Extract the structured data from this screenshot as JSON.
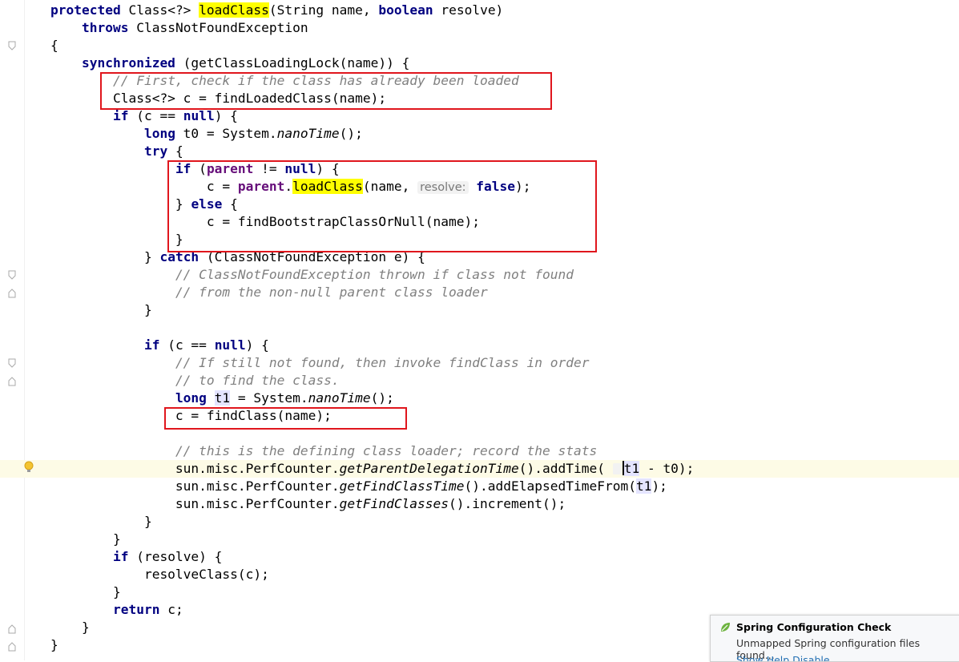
{
  "editor": {
    "lines": [
      [
        {
          "t": "protected",
          "c": "kw"
        },
        {
          "t": " Class<?> "
        },
        {
          "t": "loadClass",
          "c": "hl"
        },
        {
          "t": "(String name, "
        },
        {
          "t": "boolean",
          "c": "kw"
        },
        {
          "t": " resolve)"
        }
      ],
      [
        {
          "t": "    "
        },
        {
          "t": "throws",
          "c": "kw"
        },
        {
          "t": " ClassNotFoundException"
        }
      ],
      [
        {
          "t": "{"
        }
      ],
      [
        {
          "t": "    "
        },
        {
          "t": "synchronized",
          "c": "kw"
        },
        {
          "t": " (getClassLoadingLock(name)) {"
        }
      ],
      [
        {
          "t": "        "
        },
        {
          "t": "// First, check if the class has already been loaded",
          "c": "cm"
        }
      ],
      [
        {
          "t": "        Class<?> c = findLoadedClass(name);"
        }
      ],
      [
        {
          "t": "        "
        },
        {
          "t": "if",
          "c": "kw"
        },
        {
          "t": " (c == "
        },
        {
          "t": "null",
          "c": "kw"
        },
        {
          "t": ") {"
        }
      ],
      [
        {
          "t": "            "
        },
        {
          "t": "long",
          "c": "kw"
        },
        {
          "t": " t0 = System."
        },
        {
          "t": "nanoTime",
          "c": "it"
        },
        {
          "t": "();"
        }
      ],
      [
        {
          "t": "            "
        },
        {
          "t": "try",
          "c": "kw"
        },
        {
          "t": " {"
        }
      ],
      [
        {
          "t": "                "
        },
        {
          "t": "if",
          "c": "kw"
        },
        {
          "t": " ("
        },
        {
          "t": "parent",
          "c": "fld"
        },
        {
          "t": " != "
        },
        {
          "t": "null",
          "c": "kw"
        },
        {
          "t": ") {"
        }
      ],
      [
        {
          "t": "                    c = "
        },
        {
          "t": "parent",
          "c": "fld"
        },
        {
          "t": "."
        },
        {
          "t": "loadClass",
          "c": "hl"
        },
        {
          "t": "(name, "
        },
        {
          "t": "resolve:",
          "c": "hint"
        },
        {
          "t": " "
        },
        {
          "t": "false",
          "c": "kw"
        },
        {
          "t": ");"
        }
      ],
      [
        {
          "t": "                } "
        },
        {
          "t": "else",
          "c": "kw"
        },
        {
          "t": " {"
        }
      ],
      [
        {
          "t": "                    c = findBootstrapClassOrNull(name);"
        }
      ],
      [
        {
          "t": "                }"
        }
      ],
      [
        {
          "t": "            } "
        },
        {
          "t": "catch",
          "c": "kw"
        },
        {
          "t": " (ClassNotFoundException e) {"
        }
      ],
      [
        {
          "t": "                "
        },
        {
          "t": "// ClassNotFoundException thrown if class not found",
          "c": "cm"
        }
      ],
      [
        {
          "t": "                "
        },
        {
          "t": "// from the non-null parent class loader",
          "c": "cm"
        }
      ],
      [
        {
          "t": "            }"
        }
      ],
      [
        {
          "t": ""
        }
      ],
      [
        {
          "t": "            "
        },
        {
          "t": "if",
          "c": "kw"
        },
        {
          "t": " (c == "
        },
        {
          "t": "null",
          "c": "kw"
        },
        {
          "t": ") {"
        }
      ],
      [
        {
          "t": "                "
        },
        {
          "t": "// If still not found, then invoke findClass in order",
          "c": "cm"
        }
      ],
      [
        {
          "t": "                "
        },
        {
          "t": "// to find the class.",
          "c": "cm"
        }
      ],
      [
        {
          "t": "                "
        },
        {
          "t": "long",
          "c": "kw"
        },
        {
          "t": " "
        },
        {
          "t": "t1",
          "c": "var"
        },
        {
          "t": " = System."
        },
        {
          "t": "nanoTime",
          "c": "it"
        },
        {
          "t": "();"
        }
      ],
      [
        {
          "t": "                c = findClass(name);"
        }
      ],
      [
        {
          "t": ""
        }
      ],
      [
        {
          "t": "                "
        },
        {
          "t": "// this is the defining class loader; record the stats",
          "c": "cm"
        }
      ],
      [
        {
          "t": "                sun.misc.PerfCounter."
        },
        {
          "t": "getParentDelegationTime",
          "c": "it"
        },
        {
          "t": "().addTime( "
        },
        {
          "t": "",
          "c": "hintempty"
        },
        {
          "t": "",
          "c": "caret"
        },
        {
          "t": "t1",
          "c": "var"
        },
        {
          "t": " - t0);"
        }
      ],
      [
        {
          "t": "                sun.misc.PerfCounter."
        },
        {
          "t": "getFindClassTime",
          "c": "it"
        },
        {
          "t": "().addElapsedTimeFrom("
        },
        {
          "t": "t1",
          "c": "var"
        },
        {
          "t": ");"
        }
      ],
      [
        {
          "t": "                sun.misc.PerfCounter."
        },
        {
          "t": "getFindClasses",
          "c": "it"
        },
        {
          "t": "().increment();"
        }
      ],
      [
        {
          "t": "            }"
        }
      ],
      [
        {
          "t": "        }"
        }
      ],
      [
        {
          "t": "        "
        },
        {
          "t": "if",
          "c": "kw"
        },
        {
          "t": " (resolve) {"
        }
      ],
      [
        {
          "t": "            resolveClass(c);"
        }
      ],
      [
        {
          "t": "        }"
        }
      ],
      [
        {
          "t": "        "
        },
        {
          "t": "return",
          "c": "kw"
        },
        {
          "t": " c;"
        }
      ],
      [
        {
          "t": "    }"
        }
      ],
      [
        {
          "t": "}"
        }
      ]
    ]
  },
  "notification": {
    "title": "Spring Configuration Check",
    "body": "Unmapped Spring configuration files found...",
    "links": "Show Help   Disable"
  },
  "colors": {
    "keyword": "#000080",
    "comment": "#808080",
    "field": "#660e7a",
    "highlight": "#ffff00",
    "annotation_box": "#e0161d"
  }
}
